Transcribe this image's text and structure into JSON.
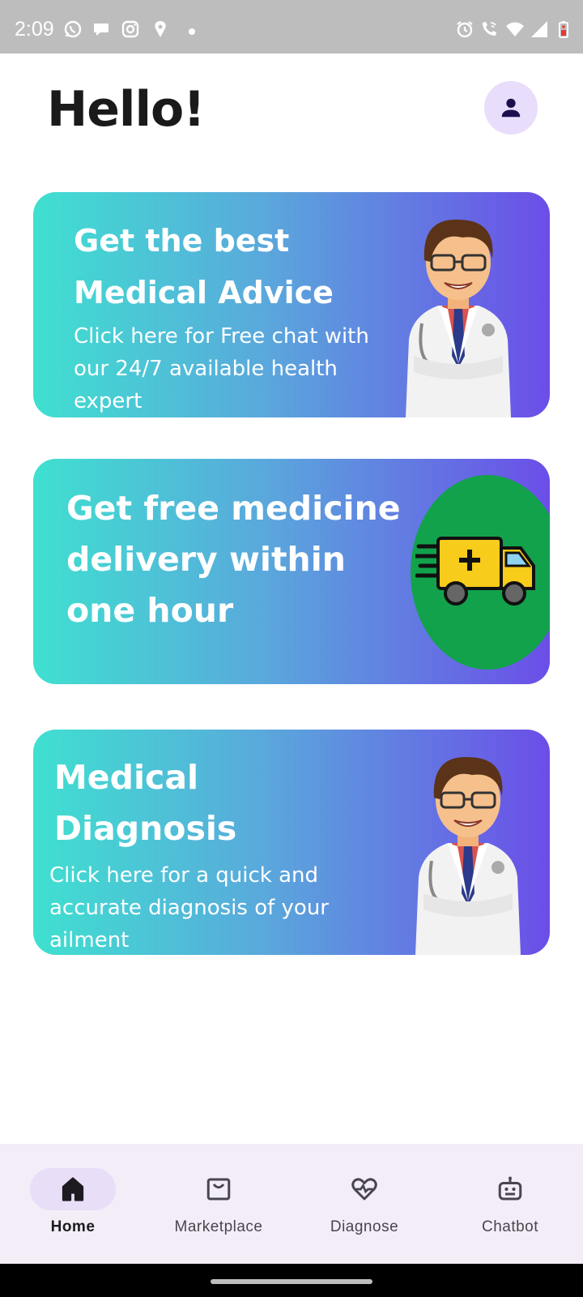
{
  "status_bar": {
    "time": "2:09",
    "left_icons": [
      "whatsapp-icon",
      "chat-bubble-icon",
      "instagram-icon",
      "location-pin-icon",
      "dot-icon"
    ],
    "right_icons": [
      "alarm-icon",
      "wifi-call-icon",
      "wifi-icon",
      "signal-icon",
      "battery-icon"
    ]
  },
  "header": {
    "greeting": "Hello!",
    "profile_icon": "person-icon"
  },
  "cards": [
    {
      "title": "Get the best Medical Advice",
      "subtitle": "Click here for Free chat with our 24/7 available health expert",
      "illustration": "doctor-illustration"
    },
    {
      "title": "Get free medicine delivery within one hour",
      "illustration": "delivery-van-illustration"
    },
    {
      "title": "Medical Diagnosis",
      "subtitle": "Click here for a quick and accurate diagnosis of your ailment",
      "illustration": "doctor-illustration"
    }
  ],
  "nav": {
    "items": [
      {
        "label": "Home",
        "icon": "home-icon",
        "active": true
      },
      {
        "label": "Marketplace",
        "icon": "shopping-bag-icon",
        "active": false
      },
      {
        "label": "Diagnose",
        "icon": "heart-pulse-icon",
        "active": false
      },
      {
        "label": "Chatbot",
        "icon": "robot-icon",
        "active": false
      }
    ]
  },
  "colors": {
    "gradient_start": "#3fe0d0",
    "gradient_end": "#6b4ee8",
    "nav_background": "#f3edf7",
    "active_pill": "#e8def8",
    "avatar_background": "#e8ddfa",
    "van_background": "#12a24c"
  }
}
